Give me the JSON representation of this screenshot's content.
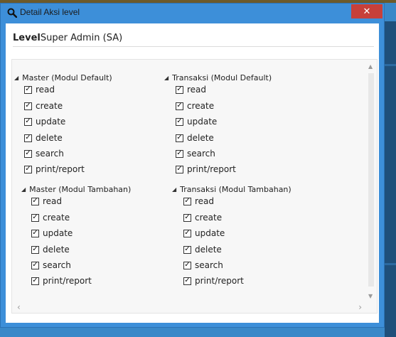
{
  "window": {
    "title": "Detail Aksi level",
    "close_symbol": "✕"
  },
  "level": {
    "label": "Level",
    "value": "Super Admin (SA)"
  },
  "groups": [
    {
      "name": "Master (Modul Default)",
      "items": [
        "read",
        "create",
        "update",
        "delete",
        "search",
        "print/report"
      ],
      "checked": [
        true,
        true,
        true,
        true,
        true,
        true
      ]
    },
    {
      "name": "Transaksi (Modul Default)",
      "items": [
        "read",
        "create",
        "update",
        "delete",
        "search",
        "print/report"
      ],
      "checked": [
        true,
        true,
        true,
        true,
        true,
        true
      ]
    },
    {
      "name": "Master (Modul Tambahan)",
      "items": [
        "read",
        "create",
        "update",
        "delete",
        "search",
        "print/report"
      ],
      "checked": [
        true,
        true,
        true,
        true,
        true,
        true
      ]
    },
    {
      "name": "Transaksi (Modul Tambahan)",
      "items": [
        "read",
        "create",
        "update",
        "delete",
        "search",
        "print/report"
      ],
      "checked": [
        true,
        true,
        true,
        true,
        true,
        true
      ]
    }
  ],
  "icons": {
    "title": "search-icon",
    "expand": "collapse-triangle-icon",
    "checkbox": "checkmark-icon"
  },
  "colors": {
    "window_frame": "#3d8fd9",
    "close_button": "#c7403a"
  }
}
